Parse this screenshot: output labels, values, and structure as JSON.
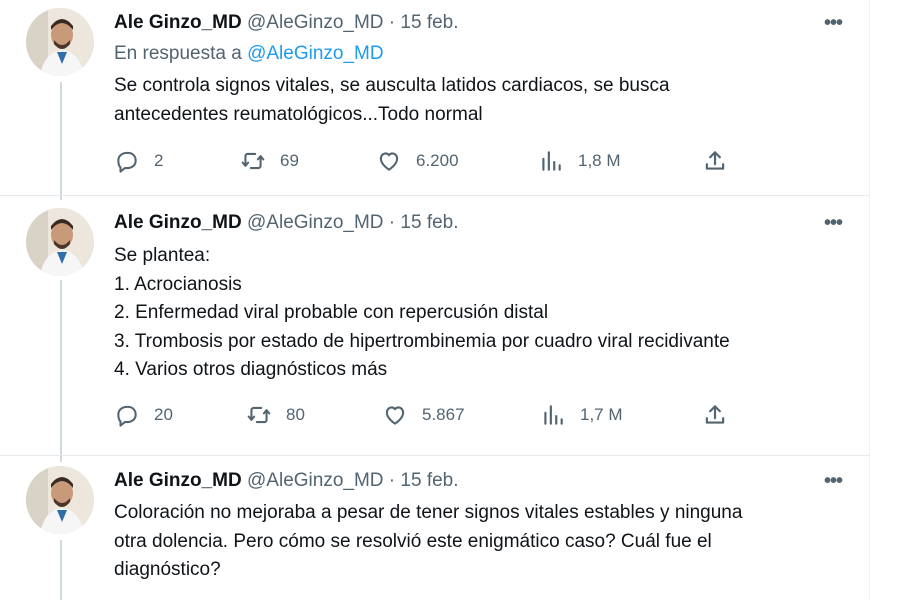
{
  "tweets": [
    {
      "name": "Ale Ginzo_MD",
      "handle": "@AleGinzo_MD",
      "separator": "·",
      "date": "15 feb.",
      "reply_prefix": "En respuesta a",
      "reply_mention": "@AleGinzo_MD",
      "lines": [
        "Se controla signos vitales, se ausculta latidos cardiacos, se busca",
        "antecedentes reumatológicos...Todo normal"
      ],
      "stats": {
        "replies": "2",
        "retweets": "69",
        "likes": "6.200",
        "views": "1,8 M"
      }
    },
    {
      "name": "Ale Ginzo_MD",
      "handle": "@AleGinzo_MD",
      "separator": "·",
      "date": "15 feb.",
      "lines": [
        "Se plantea:",
        "1. Acrocianosis",
        "2. Enfermedad viral probable con repercusión distal",
        "3. Trombosis por estado de hipertrombinemia por cuadro viral recidivante",
        "4. Varios otros diagnósticos más"
      ],
      "stats": {
        "replies": "20",
        "retweets": "80",
        "likes": "5.867",
        "views": "1,7 M"
      }
    },
    {
      "name": "Ale Ginzo_MD",
      "handle": "@AleGinzo_MD",
      "separator": "·",
      "date": "15 feb.",
      "lines": [
        "Coloración no mejoraba a pesar de tener signos vitales estables y ninguna",
        "otra dolencia. Pero cómo se resolvió este enigmático caso? Cuál fue el",
        "diagnóstico?"
      ]
    }
  ],
  "more_label": "•••",
  "icons": {
    "reply": "reply-icon",
    "retweet": "retweet-icon",
    "like": "heart-icon",
    "views": "views-icon",
    "share": "share-icon"
  },
  "colors": {
    "link": "#1d9bf0",
    "secondary": "#536471",
    "text": "#0f1419"
  }
}
